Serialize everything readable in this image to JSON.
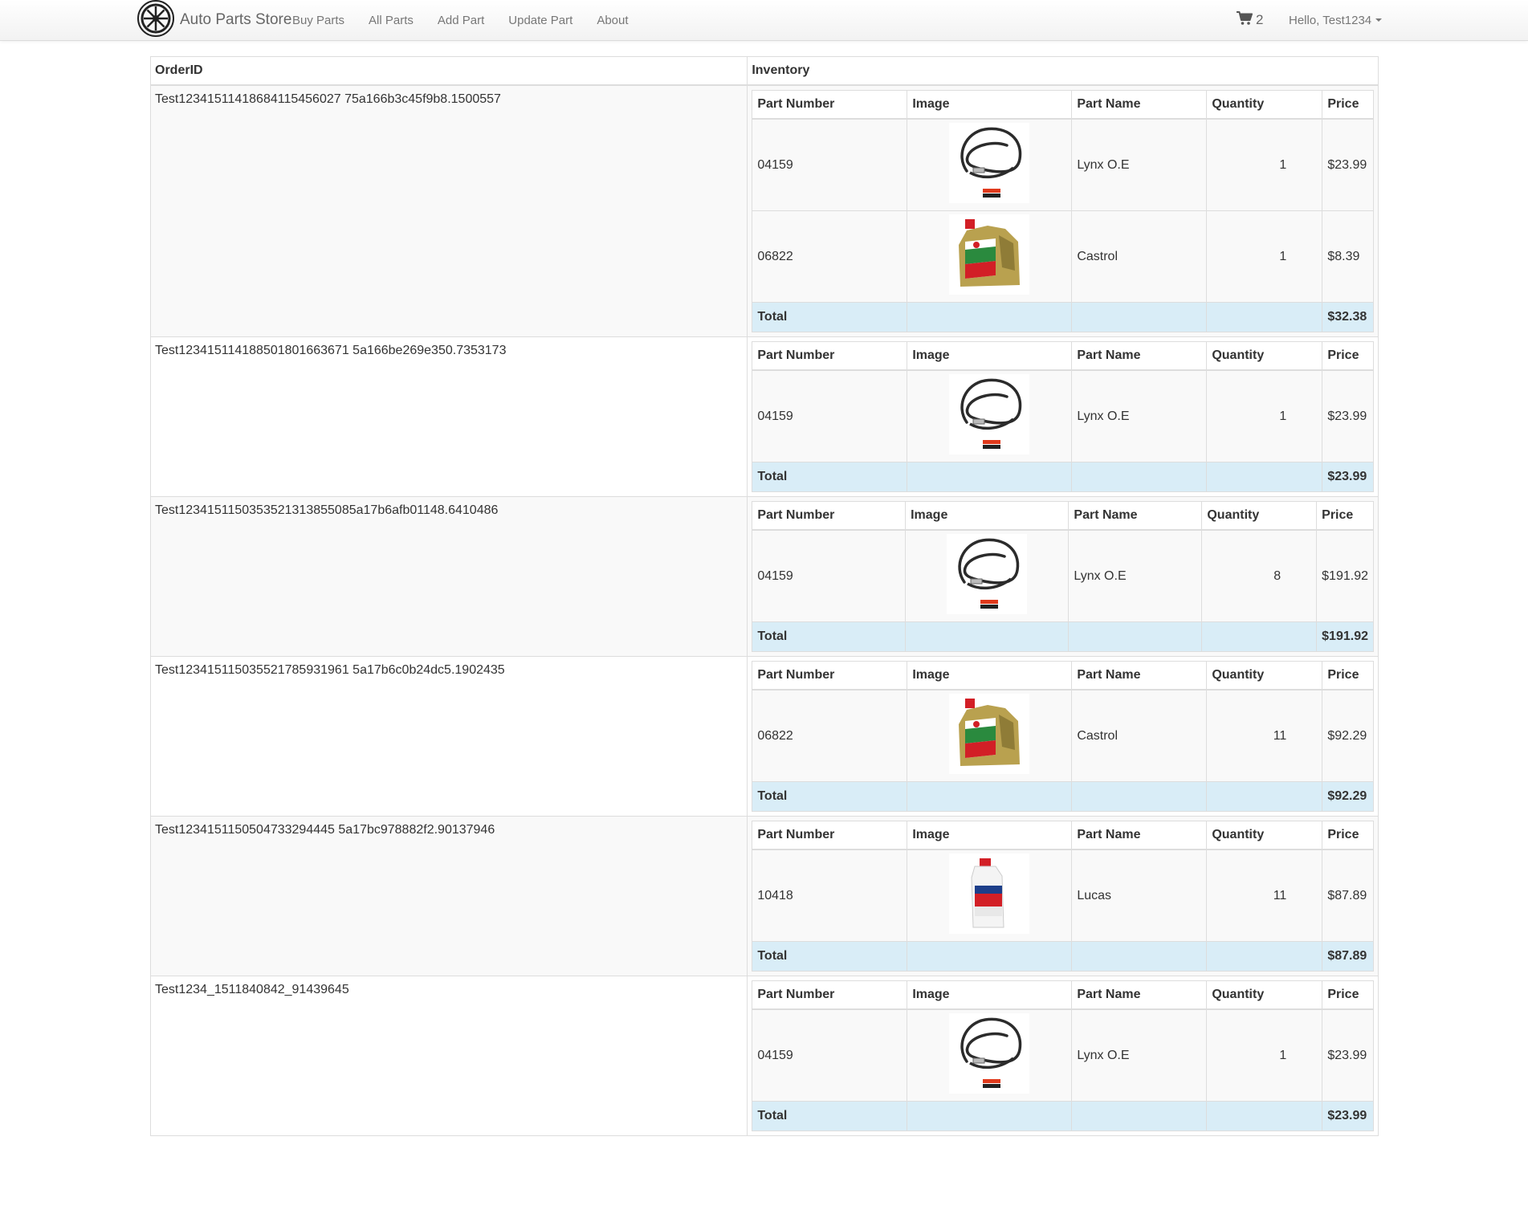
{
  "navbar": {
    "brand": "Auto Parts Store",
    "links": [
      "Buy Parts",
      "All Parts",
      "Add Part",
      "Update Part",
      "About"
    ],
    "cart_count": "2",
    "user_greeting": "Hello, Test1234"
  },
  "table": {
    "col_order_id": "OrderID",
    "col_inventory": "Inventory"
  },
  "inner_headers": {
    "part_number": "Part Number",
    "image": "Image",
    "part_name": "Part Name",
    "quantity": "Quantity",
    "price": "Price"
  },
  "total_label": "Total",
  "orders": [
    {
      "order_id": "Test12341511418684115456027 75a166b3c45f9b8.1500557",
      "items": [
        {
          "part_number": "04159",
          "image": "battery-cable",
          "part_name": "Lynx O.E",
          "quantity": "1",
          "price": "$23.99"
        },
        {
          "part_number": "06822",
          "image": "castrol-oil-jug",
          "part_name": "Castrol",
          "quantity": "1",
          "price": "$8.39"
        }
      ],
      "total": "$32.38"
    },
    {
      "order_id": "Test123415114188501801663671 5a166be269e350.7353173",
      "items": [
        {
          "part_number": "04159",
          "image": "battery-cable",
          "part_name": "Lynx O.E",
          "quantity": "1",
          "price": "$23.99"
        }
      ],
      "total": "$23.99"
    },
    {
      "order_id": "Test1234151150353521313855085a17b6afb01148.6410486",
      "items": [
        {
          "part_number": "04159",
          "image": "battery-cable",
          "part_name": "Lynx O.E",
          "quantity": "8",
          "price": "$191.92"
        }
      ],
      "total": "$191.92"
    },
    {
      "order_id": "Test123415115035521785931961 5a17b6c0b24dc5.1902435",
      "items": [
        {
          "part_number": "06822",
          "image": "castrol-oil-jug",
          "part_name": "Castrol",
          "quantity": "11",
          "price": "$92.29"
        }
      ],
      "total": "$92.29"
    },
    {
      "order_id": "Test1234151150504733294445 5a17bc978882f2.90137946",
      "items": [
        {
          "part_number": "10418",
          "image": "lucas-oil-bottle",
          "part_name": "Lucas",
          "quantity": "11",
          "price": "$87.89"
        }
      ],
      "total": "$87.89"
    },
    {
      "order_id": "Test1234_1511840842_91439645",
      "items": [
        {
          "part_number": "04159",
          "image": "battery-cable",
          "part_name": "Lynx O.E",
          "quantity": "1",
          "price": "$23.99"
        }
      ],
      "total": "$23.99"
    }
  ]
}
